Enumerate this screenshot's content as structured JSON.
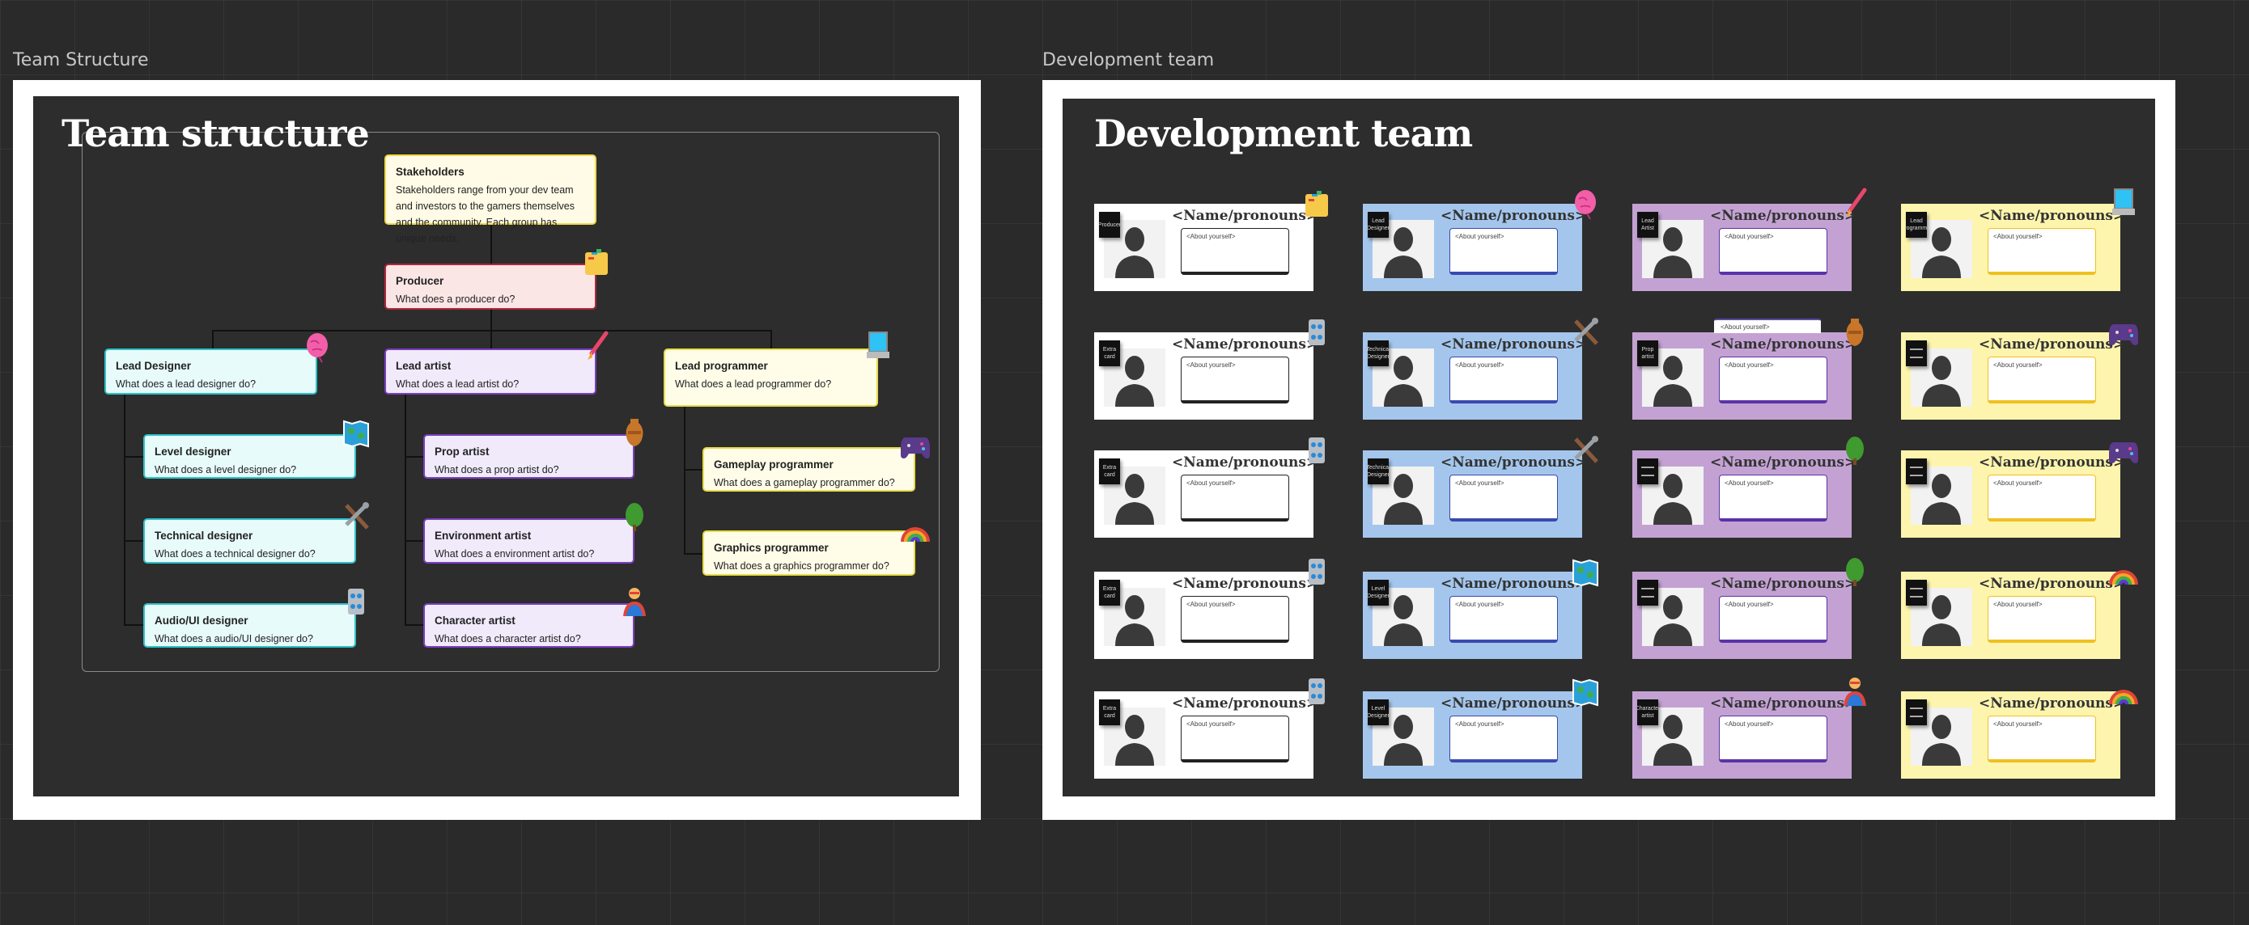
{
  "left_frame": {
    "label": "Team Structure",
    "title": "Team structure",
    "nodes": [
      {
        "id": "stakeholders",
        "title": "Stakeholders",
        "desc": "Stakeholders range from your dev team and investors to the gamers themselves and the community. Each group has unique needs.",
        "bg": "#fffbe6",
        "border": "#f2d84a",
        "icon": ""
      },
      {
        "id": "producer",
        "title": "Producer",
        "desc": "What does a producer do?",
        "bg": "#fbe6e6",
        "border": "#b0283a",
        "icon": "folder-icon"
      },
      {
        "id": "lead-designer",
        "title": "Lead Designer",
        "desc": "What does a lead designer do?",
        "bg": "#e8fbfb",
        "border": "#2cc3c8",
        "icon": "brain-icon"
      },
      {
        "id": "lead-artist",
        "title": "Lead artist",
        "desc": "What does a lead artist do?",
        "bg": "#f0eafb",
        "border": "#7a3fbf",
        "icon": "paintbrush-icon"
      },
      {
        "id": "lead-programmer",
        "title": "Lead programmer",
        "desc": "What does a lead programmer do?",
        "bg": "#fffde8",
        "border": "#e8dc4a",
        "icon": "laptop-icon"
      },
      {
        "id": "level-designer",
        "title": "Level designer",
        "desc": "What does a level designer do?",
        "bg": "#e8fbfb",
        "border": "#2cc3c8",
        "icon": "map-icon"
      },
      {
        "id": "technical-designer",
        "title": "Technical designer",
        "desc": "What does a technical designer do?",
        "bg": "#e8fbfb",
        "border": "#2cc3c8",
        "icon": "tools-icon"
      },
      {
        "id": "audio-ui-designer",
        "title": "Audio/UI designer",
        "desc": "What does a audio/UI designer do?",
        "bg": "#e8fbfb",
        "border": "#2cc3c8",
        "icon": "control-knobs-icon"
      },
      {
        "id": "prop-artist",
        "title": "Prop artist",
        "desc": "What does a prop artist do?",
        "bg": "#f0eafb",
        "border": "#7a3fbf",
        "icon": "amphora-icon"
      },
      {
        "id": "environment-artist",
        "title": "Environment artist",
        "desc": "What does a environment artist do?",
        "bg": "#f0eafb",
        "border": "#7a3fbf",
        "icon": "tree-icon"
      },
      {
        "id": "character-artist",
        "title": "Character artist",
        "desc": "What does a character artist do?",
        "bg": "#f0eafb",
        "border": "#7a3fbf",
        "icon": "superhero-icon"
      },
      {
        "id": "gameplay-programmer",
        "title": "Gameplay programmer",
        "desc": "What does a gameplay programmer do?",
        "bg": "#fffde8",
        "border": "#e8dc4a",
        "icon": "gamepad-icon"
      },
      {
        "id": "graphics-programmer",
        "title": "Graphics programmer",
        "desc": "What does a graphics programmer do?",
        "bg": "#fffde8",
        "border": "#e8dc4a",
        "icon": "rainbow-icon"
      }
    ]
  },
  "right_frame": {
    "label": "Development team",
    "title": "Development team",
    "stray_note": "<About yourself>",
    "column_colors": [
      "#ffffff",
      "#a4c6ec",
      "#c3a2d3",
      "#fdf5ad"
    ],
    "about_border_colors": [
      "#222222",
      "#3a49b0",
      "#5a33a8",
      "#f0c020"
    ],
    "cards": [
      [
        {
          "tag": "Producer",
          "icon": "folder-icon"
        },
        {
          "tag": "Lead Designer",
          "icon": "brain-icon"
        },
        {
          "tag": "Lead Artist",
          "icon": "paintbrush-icon"
        },
        {
          "tag": "Lead Programmer",
          "icon": "laptop-icon"
        }
      ],
      [
        {
          "tag": "Extra card",
          "icon": "control-knobs-icon"
        },
        {
          "tag": "Technical Designer",
          "icon": "tools-icon"
        },
        {
          "tag": "Prop artist",
          "icon": "amphora-icon"
        },
        {
          "tag": "",
          "icon": "gamepad-icon"
        }
      ],
      [
        {
          "tag": "Extra card",
          "icon": "control-knobs-icon"
        },
        {
          "tag": "Technical Designer",
          "icon": "tools-icon"
        },
        {
          "tag": "",
          "icon": "tree-icon"
        },
        {
          "tag": "",
          "icon": "gamepad-icon"
        }
      ],
      [
        {
          "tag": "Extra card",
          "icon": "control-knobs-icon"
        },
        {
          "tag": "Level Designer",
          "icon": "map-icon"
        },
        {
          "tag": "",
          "icon": "tree-icon"
        },
        {
          "tag": "",
          "icon": "rainbow-icon"
        }
      ],
      [
        {
          "tag": "Extra card",
          "icon": "control-knobs-icon"
        },
        {
          "tag": "Level Designer",
          "icon": "map-icon"
        },
        {
          "tag": "Character artist",
          "icon": "superhero-icon"
        },
        {
          "tag": "",
          "icon": "rainbow-icon"
        }
      ]
    ],
    "card_name": "<Name/pronouns>",
    "card_about": "<About yourself>"
  }
}
